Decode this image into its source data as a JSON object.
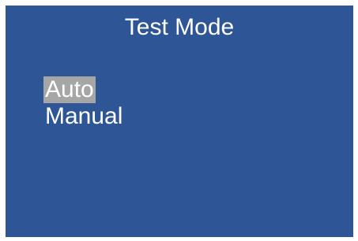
{
  "screen": {
    "title": "Test Mode",
    "menu": {
      "items": [
        {
          "label": "Auto",
          "selected": true
        },
        {
          "label": "Manual",
          "selected": false
        }
      ]
    }
  },
  "colors": {
    "background": "#2e5596",
    "text": "#ffffff",
    "selection": "#a6a6a6",
    "frame": "#ffffff"
  }
}
